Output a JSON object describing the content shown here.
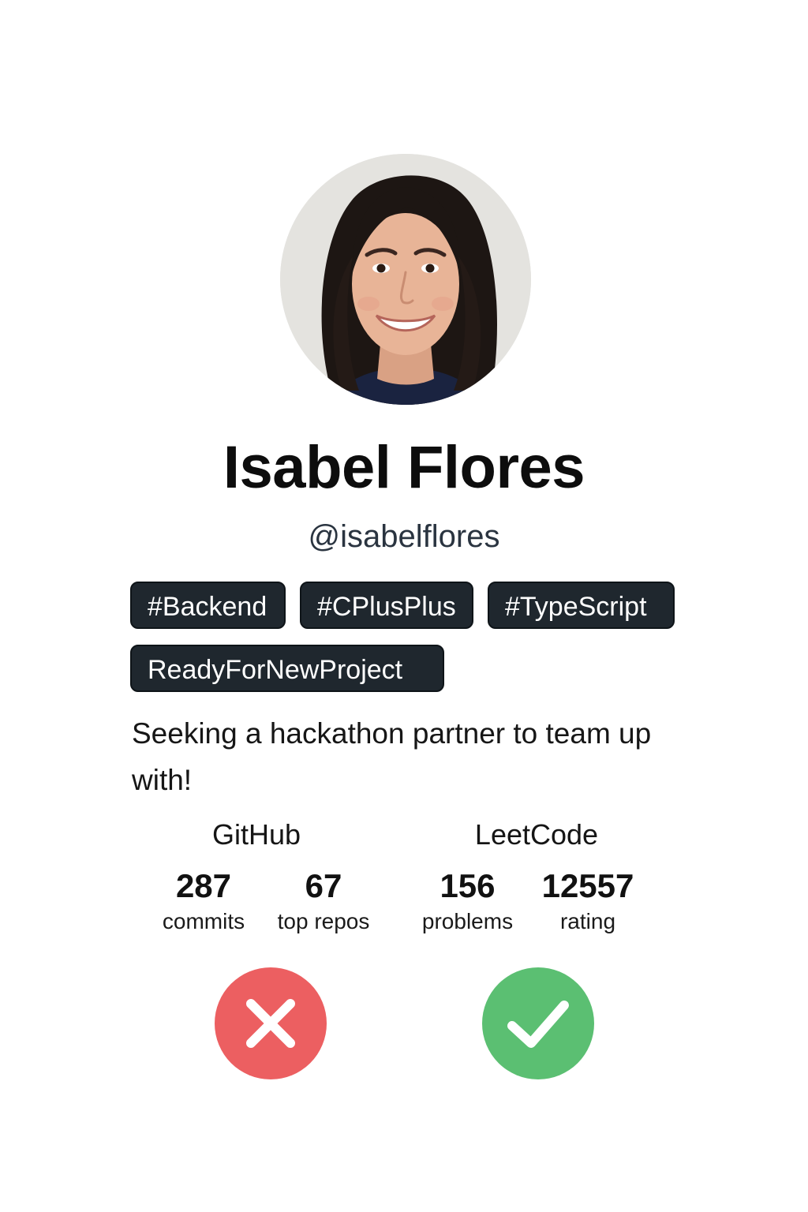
{
  "profile": {
    "name": "Isabel Flores",
    "handle": "@isabelflores",
    "avatar_icon": "profile-photo",
    "tags": [
      "#Backend",
      "#CPlusPlus",
      "#TypeScript",
      "ReadyForNewProject"
    ],
    "bio": "Seeking a hackathon partner to team up with!"
  },
  "stats": {
    "github": {
      "title": "GitHub",
      "commits": {
        "value": "287",
        "label": "commits"
      },
      "repos": {
        "value": "67",
        "label": "top repos"
      }
    },
    "leetcode": {
      "title": "LeetCode",
      "problems": {
        "value": "156",
        "label": "problems"
      },
      "rating": {
        "value": "12557",
        "label": "rating"
      }
    }
  },
  "actions": {
    "reject_icon": "close-icon",
    "accept_icon": "check-icon",
    "reject_color": "#ec5f61",
    "accept_color": "#5bbf72"
  },
  "colors": {
    "tag_background": "#1f272e",
    "handle_text": "#2a3440"
  }
}
